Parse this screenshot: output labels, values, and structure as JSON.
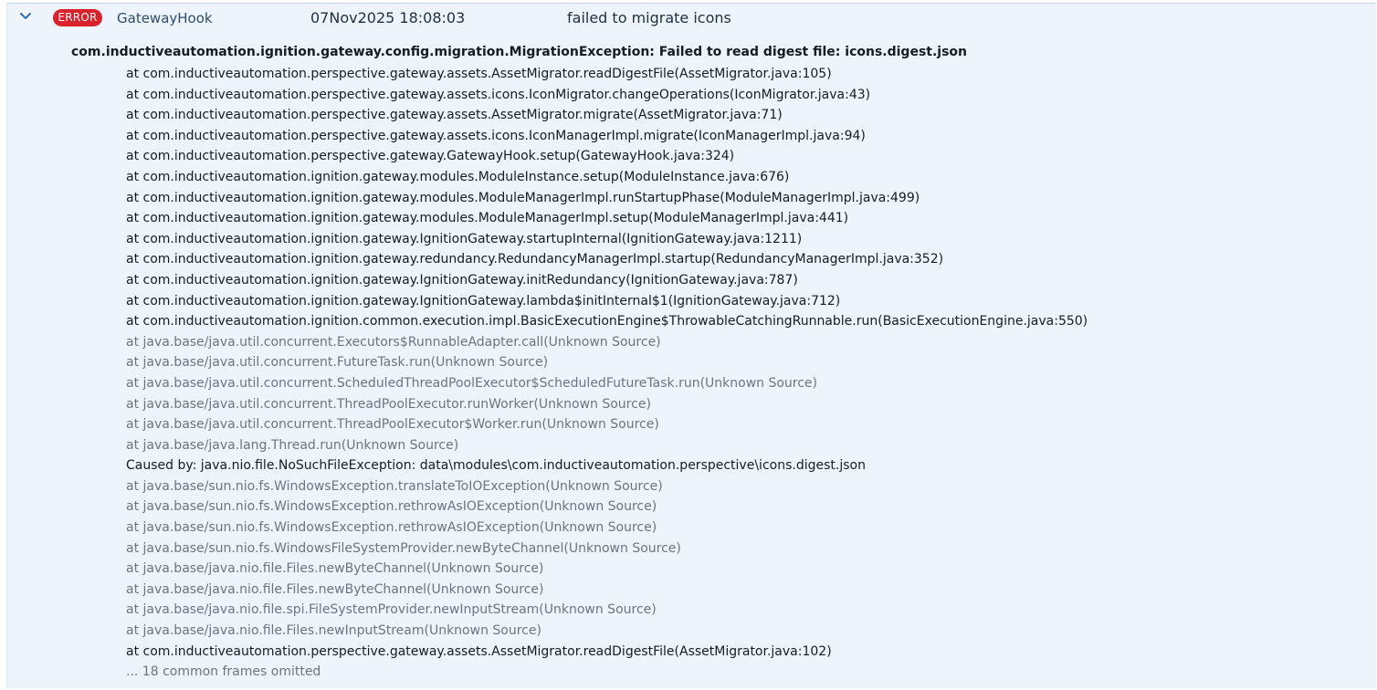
{
  "log_entry": {
    "level": "ERROR",
    "logger": "GatewayHook",
    "timestamp": "07Nov2025 18:08:03",
    "message": "failed to migrate icons",
    "exception": "com.inductiveautomation.ignition.gateway.config.migration.MigrationException: Failed to read digest file: icons.digest.json",
    "frames": [
      {
        "text": "at com.inductiveautomation.perspective.gateway.assets.AssetMigrator.readDigestFile(AssetMigrator.java:105)",
        "kind": "app"
      },
      {
        "text": "at com.inductiveautomation.perspective.gateway.assets.icons.IconMigrator.changeOperations(IconMigrator.java:43)",
        "kind": "app"
      },
      {
        "text": "at com.inductiveautomation.perspective.gateway.assets.AssetMigrator.migrate(AssetMigrator.java:71)",
        "kind": "app"
      },
      {
        "text": "at com.inductiveautomation.perspective.gateway.assets.icons.IconManagerImpl.migrate(IconManagerImpl.java:94)",
        "kind": "app"
      },
      {
        "text": "at com.inductiveautomation.perspective.gateway.GatewayHook.setup(GatewayHook.java:324)",
        "kind": "app"
      },
      {
        "text": "at com.inductiveautomation.ignition.gateway.modules.ModuleInstance.setup(ModuleInstance.java:676)",
        "kind": "app"
      },
      {
        "text": "at com.inductiveautomation.ignition.gateway.modules.ModuleManagerImpl.runStartupPhase(ModuleManagerImpl.java:499)",
        "kind": "app"
      },
      {
        "text": "at com.inductiveautomation.ignition.gateway.modules.ModuleManagerImpl.setup(ModuleManagerImpl.java:441)",
        "kind": "app"
      },
      {
        "text": "at com.inductiveautomation.ignition.gateway.IgnitionGateway.startupInternal(IgnitionGateway.java:1211)",
        "kind": "app"
      },
      {
        "text": "at com.inductiveautomation.ignition.gateway.redundancy.RedundancyManagerImpl.startup(RedundancyManagerImpl.java:352)",
        "kind": "app"
      },
      {
        "text": "at com.inductiveautomation.ignition.gateway.IgnitionGateway.initRedundancy(IgnitionGateway.java:787)",
        "kind": "app"
      },
      {
        "text": "at com.inductiveautomation.ignition.gateway.IgnitionGateway.lambda$initInternal$1(IgnitionGateway.java:712)",
        "kind": "app"
      },
      {
        "text": "at com.inductiveautomation.ignition.common.execution.impl.BasicExecutionEngine$ThrowableCatchingRunnable.run(BasicExecutionEngine.java:550)",
        "kind": "app"
      },
      {
        "text": "at java.base/java.util.concurrent.Executors$RunnableAdapter.call(Unknown Source)",
        "kind": "lib"
      },
      {
        "text": "at java.base/java.util.concurrent.FutureTask.run(Unknown Source)",
        "kind": "lib"
      },
      {
        "text": "at java.base/java.util.concurrent.ScheduledThreadPoolExecutor$ScheduledFutureTask.run(Unknown Source)",
        "kind": "lib"
      },
      {
        "text": "at java.base/java.util.concurrent.ThreadPoolExecutor.runWorker(Unknown Source)",
        "kind": "lib"
      },
      {
        "text": "at java.base/java.util.concurrent.ThreadPoolExecutor$Worker.run(Unknown Source)",
        "kind": "lib"
      },
      {
        "text": "at java.base/java.lang.Thread.run(Unknown Source)",
        "kind": "lib"
      },
      {
        "text": "Caused by: java.nio.file.NoSuchFileException: data\\modules\\com.inductiveautomation.perspective\\icons.digest.json",
        "kind": "cause"
      },
      {
        "text": "at java.base/sun.nio.fs.WindowsException.translateToIOException(Unknown Source)",
        "kind": "lib"
      },
      {
        "text": "at java.base/sun.nio.fs.WindowsException.rethrowAsIOException(Unknown Source)",
        "kind": "lib"
      },
      {
        "text": "at java.base/sun.nio.fs.WindowsException.rethrowAsIOException(Unknown Source)",
        "kind": "lib"
      },
      {
        "text": "at java.base/sun.nio.fs.WindowsFileSystemProvider.newByteChannel(Unknown Source)",
        "kind": "lib"
      },
      {
        "text": "at java.base/java.nio.file.Files.newByteChannel(Unknown Source)",
        "kind": "lib"
      },
      {
        "text": "at java.base/java.nio.file.Files.newByteChannel(Unknown Source)",
        "kind": "lib"
      },
      {
        "text": "at java.base/java.nio.file.spi.FileSystemProvider.newInputStream(Unknown Source)",
        "kind": "lib"
      },
      {
        "text": "at java.base/java.nio.file.Files.newInputStream(Unknown Source)",
        "kind": "lib"
      },
      {
        "text": "at com.inductiveautomation.perspective.gateway.assets.AssetMigrator.readDigestFile(AssetMigrator.java:102)",
        "kind": "app"
      },
      {
        "text": "... 18 common frames omitted",
        "kind": "lib"
      }
    ]
  },
  "icons": {
    "toggle": "chevron-down-icon"
  },
  "colors": {
    "panel_bg": "#eef4fb",
    "error_badge": "#d9222c",
    "app_frame_text": "#141c24",
    "lib_frame_text": "#6b7580",
    "logger_text": "#2f4c6e",
    "chevron": "#2f6fb0"
  }
}
